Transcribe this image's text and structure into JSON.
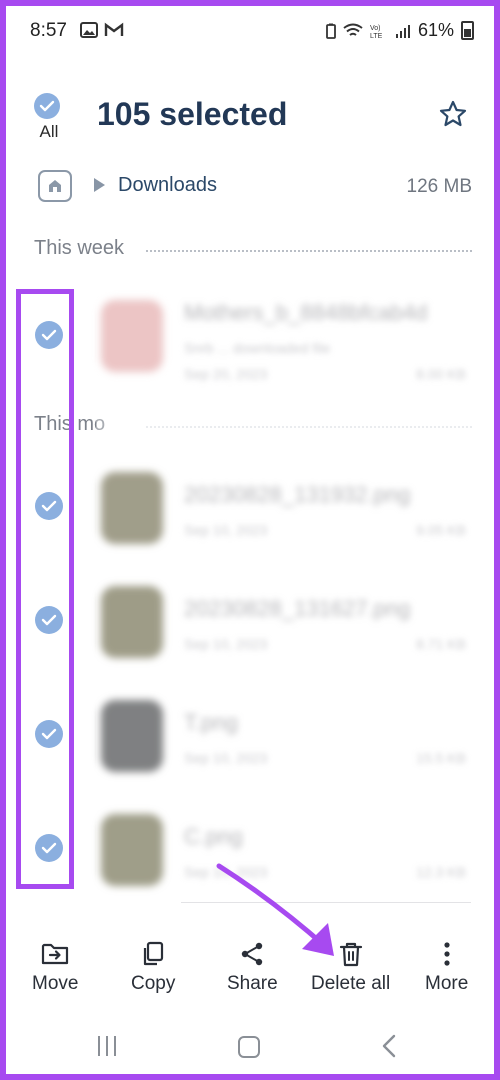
{
  "status_bar": {
    "time": "8:57",
    "battery": "61%",
    "icons": [
      "image-icon",
      "gmail-icon",
      "battery-saver-icon",
      "wifi-icon",
      "volte-icon",
      "signal-icon",
      "battery-icon"
    ]
  },
  "header": {
    "all_label": "All",
    "title": "105 selected",
    "favorite_icon": "star-icon"
  },
  "path": {
    "home_icon": "home-icon",
    "folder": "Downloads",
    "size": "126 MB"
  },
  "sections": {
    "this_week": "This week",
    "this_month": "This mo"
  },
  "files": [
    {
      "name": "Mothers_b_8848bfcab4d",
      "meta": "Snrb ... downloaded file",
      "date": "Sep 20, 2023",
      "size": "8.00 KB",
      "selected": true,
      "thumb_color": "#e2a6a6"
    },
    {
      "name": "20230828_131932.png",
      "meta": "Sep 10, 2023",
      "date": "",
      "size": "9.05 KB",
      "selected": true,
      "thumb_color": "#6e6a4c"
    },
    {
      "name": "20230828_131627.png",
      "meta": "Sep 10, 2023",
      "date": "",
      "size": "8.71 KB",
      "selected": true,
      "thumb_color": "#6b6848"
    },
    {
      "name": "T.png",
      "meta": "Sep 10, 2023",
      "date": "",
      "size": "15.5 KB",
      "selected": true,
      "thumb_color": "#3b3d3f"
    },
    {
      "name": "C.png",
      "meta": "Sep 10, 2023",
      "date": "",
      "size": "12.3 KB",
      "selected": true,
      "thumb_color": "#6c6a4a"
    }
  ],
  "toolbar": {
    "move": "Move",
    "copy": "Copy",
    "share": "Share",
    "delete_all": "Delete all",
    "more": "More"
  },
  "colors": {
    "accent": "#a74af0",
    "check": "#8bafdf",
    "title": "#223856"
  }
}
